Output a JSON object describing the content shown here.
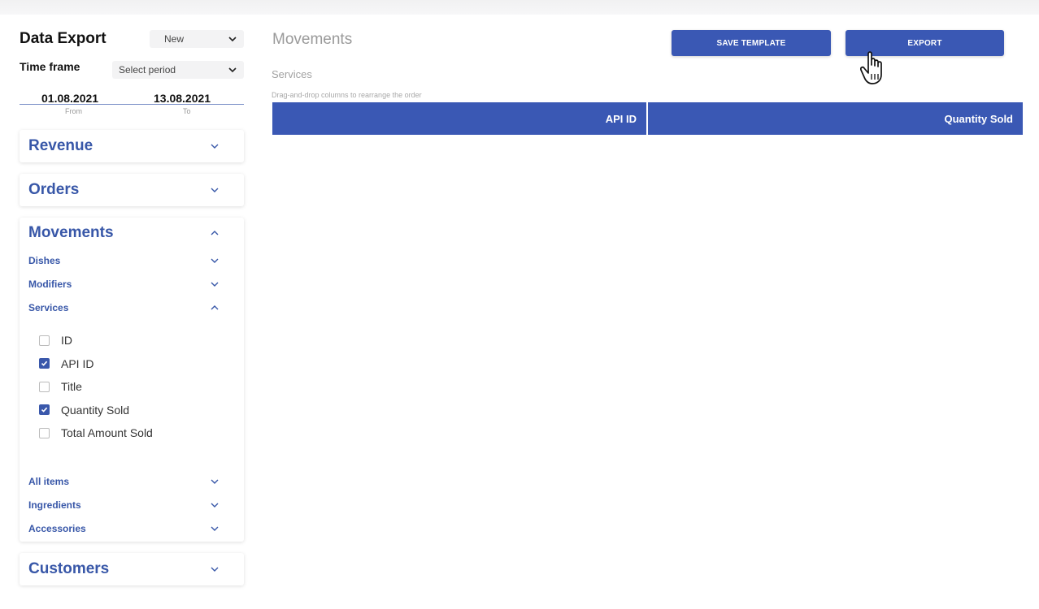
{
  "sidebar": {
    "title": "Data Export",
    "template_select": "New",
    "timeframe_label": "Time frame",
    "period_select": "Select period",
    "date_from": "01.08.2021",
    "date_from_label": "From",
    "date_to": "13.08.2021",
    "date_to_label": "To",
    "sections": {
      "revenue": "Revenue",
      "orders": "Orders",
      "movements": "Movements",
      "customers": "Customers"
    },
    "movements_items": {
      "dishes": "Dishes",
      "modifiers": "Modifiers",
      "services": "Services",
      "all_items": "All items",
      "ingredients": "Ingredients",
      "accessories": "Accessories"
    },
    "services_fields": [
      {
        "label": "ID",
        "checked": false
      },
      {
        "label": "API ID",
        "checked": true
      },
      {
        "label": "Title",
        "checked": false
      },
      {
        "label": "Quantity Sold",
        "checked": true
      },
      {
        "label": "Total Amount Sold",
        "checked": false
      }
    ]
  },
  "main": {
    "title": "Movements",
    "save_template": "SAVE TEMPLATE",
    "export": "EXPORT",
    "subtitle": "Services",
    "hint": "Drag-and-drop columns to rearrange the order",
    "columns": [
      "API ID",
      "Quantity Sold"
    ]
  },
  "colors": {
    "accent": "#3a58b4",
    "section_text": "#3857a8"
  },
  "icons": [
    "chevron-down-icon",
    "chevron-up-icon",
    "checkbox-icon",
    "hand-pointer-cursor-icon"
  ]
}
